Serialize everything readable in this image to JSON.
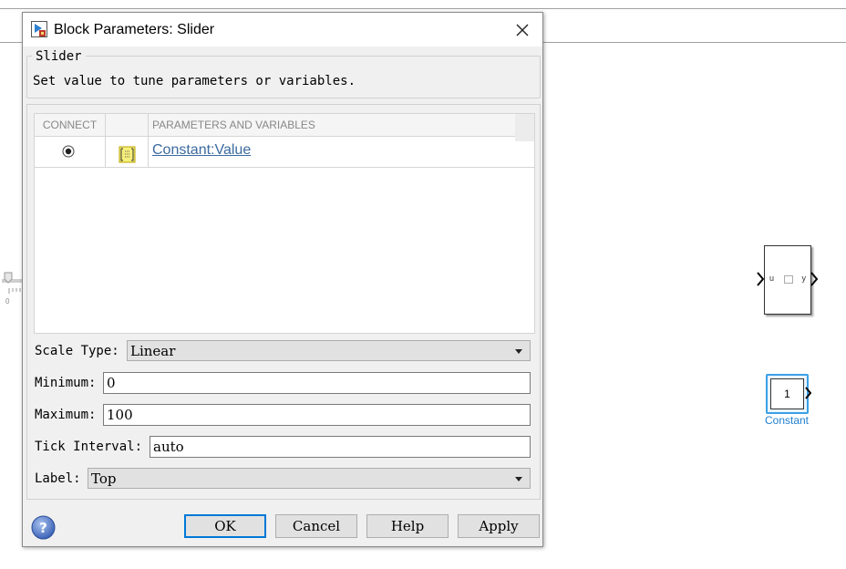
{
  "dialog": {
    "title": "Block Parameters: Slider",
    "group_title": "Slider",
    "description": "Set value to tune parameters or variables."
  },
  "table": {
    "columns": [
      "CONNECT",
      "",
      "PARAMETERS AND VARIABLES"
    ],
    "rows": [
      {
        "connected": true,
        "parameter": "Constant:Value"
      }
    ]
  },
  "form": {
    "scale_type_label": "Scale Type:",
    "scale_type_value": "Linear",
    "minimum_label": "Minimum:",
    "minimum_value": "0",
    "maximum_label": "Maximum:",
    "maximum_value": "100",
    "tick_interval_label": "Tick Interval:",
    "tick_interval_value": "auto",
    "label_label": "Label:",
    "label_value": "Top"
  },
  "buttons": {
    "ok": "OK",
    "cancel": "Cancel",
    "help": "Help",
    "apply": "Apply"
  },
  "canvas": {
    "slider_tick_zero": "0",
    "subsystem_in_port": "u",
    "subsystem_out_port": "y",
    "constant_value": "1",
    "constant_label": "Constant"
  },
  "colors": {
    "accent": "#0078d7",
    "link": "#3b6aa0",
    "selected_block": "#3aa0e6"
  },
  "icons": {
    "title": "simulink-block-icon",
    "close": "close-icon",
    "param": "parameter-icon",
    "help": "help-icon"
  }
}
